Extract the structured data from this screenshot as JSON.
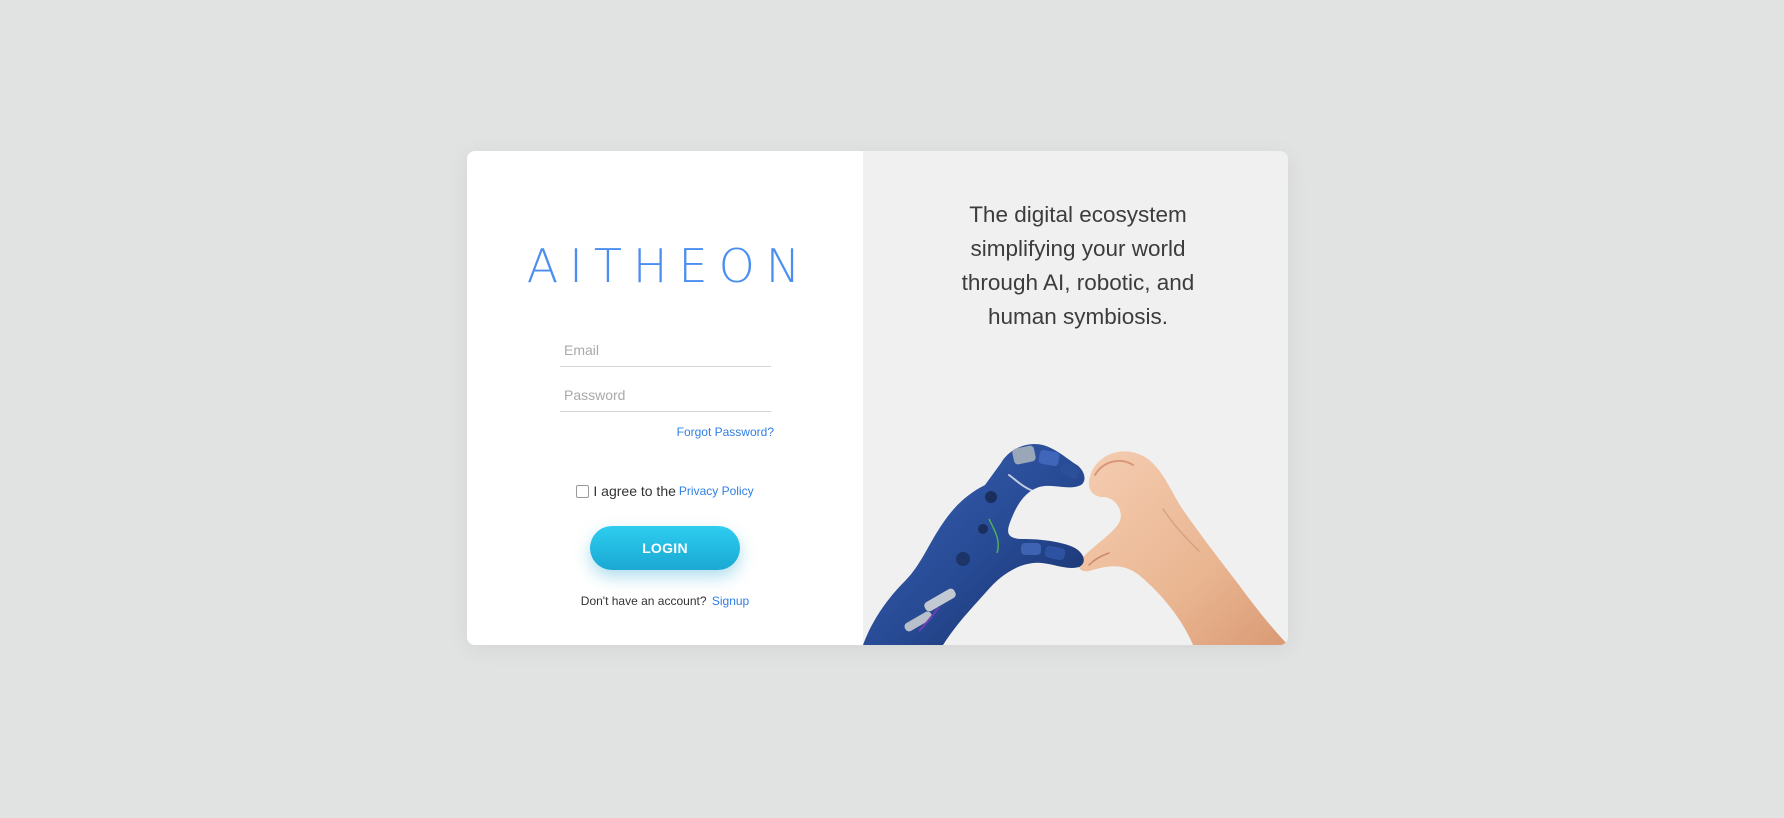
{
  "brand": {
    "logo_text": "AITHEON",
    "accent_color": "#4a8ef0",
    "link_color": "#2f7fe2",
    "button_gradient": [
      "#2ecdf0",
      "#1aa8d2"
    ]
  },
  "login_form": {
    "email": {
      "value": "",
      "placeholder": "Email"
    },
    "password": {
      "value": "",
      "placeholder": "Password"
    },
    "forgot_password_label": "Forgot Password?",
    "agree": {
      "checked": false,
      "text": "I agree to the",
      "link_label": "Privacy Policy"
    },
    "login_button_label": "LOGIN",
    "signup": {
      "prompt": "Don't have an account?",
      "link_label": "Signup"
    }
  },
  "hero": {
    "tagline_lines": [
      "The digital ecosystem",
      "simplifying your world",
      "through AI, robotic, and",
      "human symbiosis."
    ],
    "illustration": "robot-and-human-hands-heart"
  }
}
